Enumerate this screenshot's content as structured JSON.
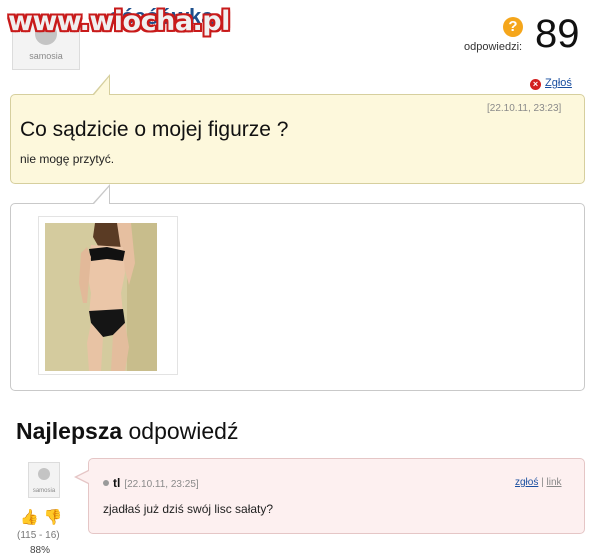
{
  "watermark": "www.wiocha.pl",
  "asker": {
    "username": "...ośąśówka",
    "avatar_caption": "samosia"
  },
  "answers": {
    "label": "odpowiedzi:",
    "count": "89"
  },
  "report": {
    "label": "Zgłoś"
  },
  "question": {
    "date": "[22.10.11, 23:23]",
    "title": "Co sądzicie o mojej figurze ?",
    "body": "nie mogę przytyć."
  },
  "best_answer": {
    "heading_bold": "Najlepsza",
    "heading_rest": " odpowiedź",
    "avatar_caption": "samosia",
    "user": "tl",
    "date": "[22.10.11, 23:25]",
    "report_label": "zgłoś",
    "separator": "|",
    "link_label": "link",
    "text": "zjadłaś już dziś swój lisc sałaty?",
    "votes": "(115 - 16)",
    "percent": "88%"
  },
  "icons": {
    "question": "question-icon",
    "report": "report-x-icon",
    "thumb_up": "thumb-up-icon",
    "thumb_down": "thumb-down-icon"
  },
  "colors": {
    "username": "#1d4f8c",
    "question_bg": "#fdf8dc",
    "answer_bg": "#fdf0f0",
    "watermark_outline": "#c81a1a",
    "badge_orange": "#f5a61b"
  }
}
